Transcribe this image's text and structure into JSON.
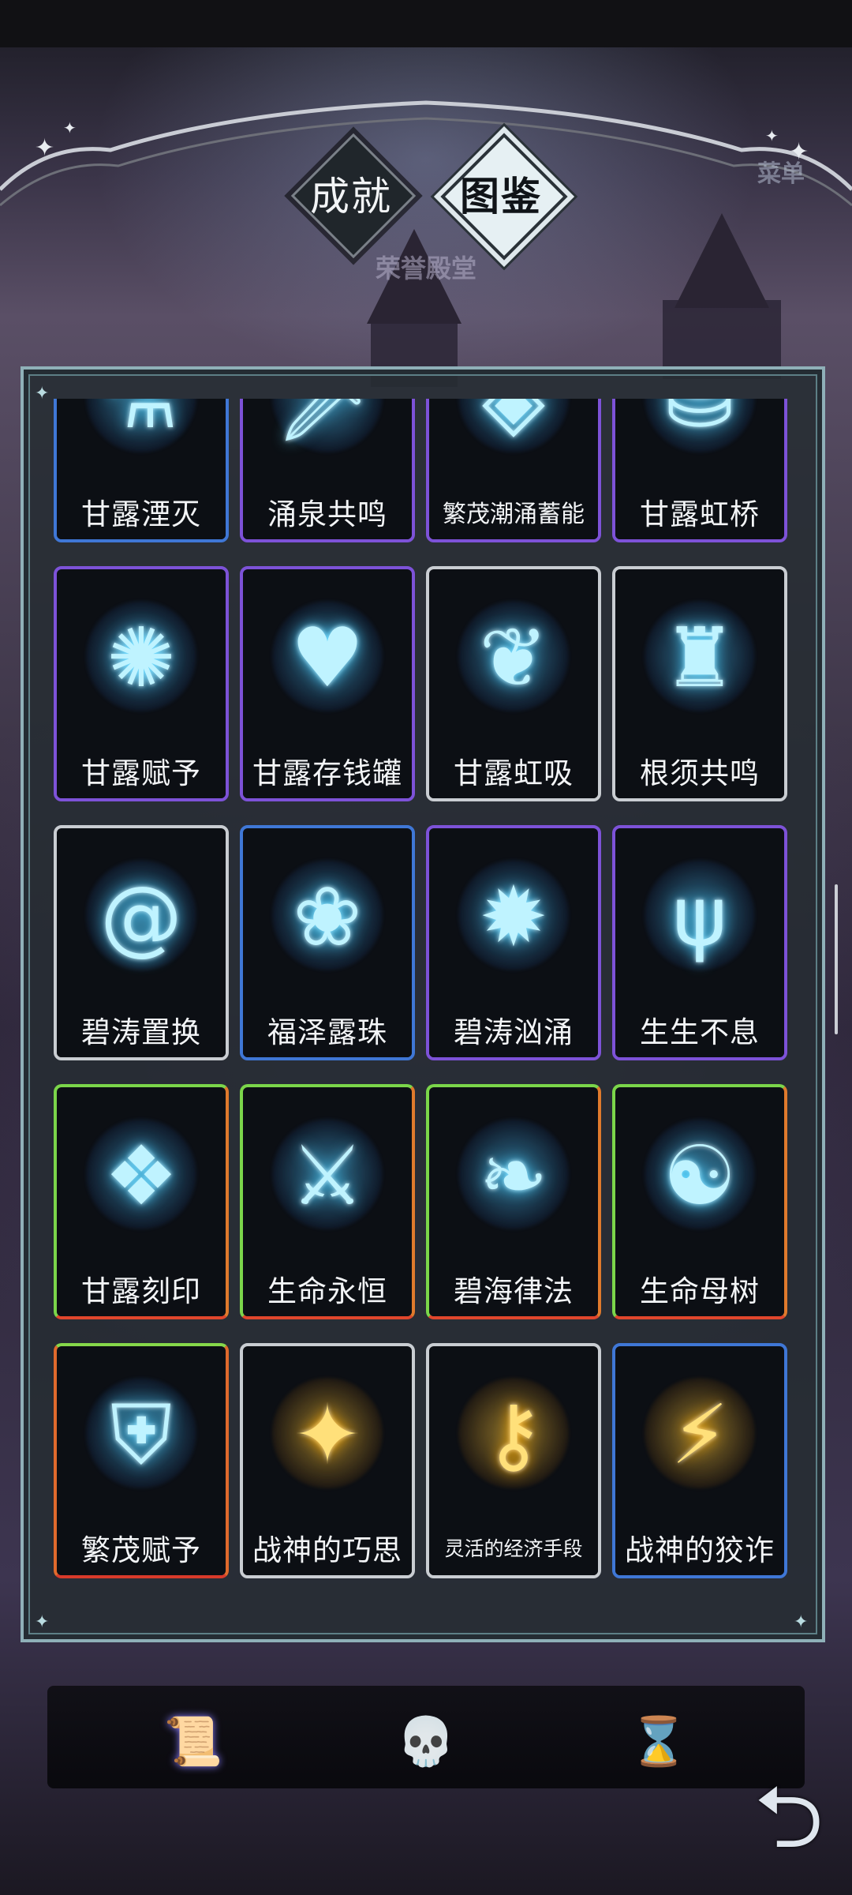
{
  "tabs": [
    {
      "label": "成就",
      "active": false
    },
    {
      "label": "图鉴",
      "active": true
    }
  ],
  "subtitle": "荣誉殿堂",
  "corner_text": "菜单",
  "cards": [
    {
      "name": "甘露湮灭",
      "icon": "crystal-vial-icon",
      "frame": "blue"
    },
    {
      "name": "涌泉共鸣",
      "icon": "sword-swirl-icon",
      "frame": "purple"
    },
    {
      "name": "繁茂潮涌蓄能",
      "icon": "crystal-orb-icon",
      "frame": "purple"
    },
    {
      "name": "甘露虹桥",
      "icon": "coin-jar-icon",
      "frame": "purple"
    },
    {
      "name": "甘露赋予",
      "icon": "vortex-shield-icon",
      "frame": "purple"
    },
    {
      "name": "甘露存钱罐",
      "icon": "heart-drop-icon",
      "frame": "purple"
    },
    {
      "name": "甘露虹吸",
      "icon": "water-lotus-icon",
      "frame": "silver"
    },
    {
      "name": "根须共鸣",
      "icon": "flame-helmet-icon",
      "frame": "silver"
    },
    {
      "name": "碧涛置换",
      "icon": "whirlpool-icon",
      "frame": "silver"
    },
    {
      "name": "福泽露珠",
      "icon": "laurel-wreath-icon",
      "frame": "blue"
    },
    {
      "name": "碧涛汹涌",
      "icon": "splash-orb-icon",
      "frame": "purple"
    },
    {
      "name": "生生不息",
      "icon": "trident-swirl-icon",
      "frame": "purple"
    },
    {
      "name": "甘露刻印",
      "icon": "winged-halo-icon",
      "frame": "green-orange"
    },
    {
      "name": "生命永恒",
      "icon": "crystal-sword-icon",
      "frame": "green-orange"
    },
    {
      "name": "碧海律法",
      "icon": "sprout-hands-icon",
      "frame": "green-orange"
    },
    {
      "name": "生命母树",
      "icon": "orbit-orb-icon",
      "frame": "green-orange"
    },
    {
      "name": "繁茂赋予",
      "icon": "knight-shield-icon",
      "frame": "green-red"
    },
    {
      "name": "战神的巧思",
      "icon": "golden-vortex-icon",
      "frame": "silver"
    },
    {
      "name": "灵活的经济手段",
      "icon": "golden-key-ring-icon",
      "frame": "silver"
    },
    {
      "name": "战神的狡诈",
      "icon": "lightning-sword-icon",
      "frame": "blue"
    }
  ],
  "bottom_nav": [
    {
      "icon": "scroll-icon",
      "active": true
    },
    {
      "icon": "skull-icon",
      "active": false
    },
    {
      "icon": "hourglass-icon",
      "active": false
    }
  ],
  "back_button_icon": "return-arrow-icon"
}
